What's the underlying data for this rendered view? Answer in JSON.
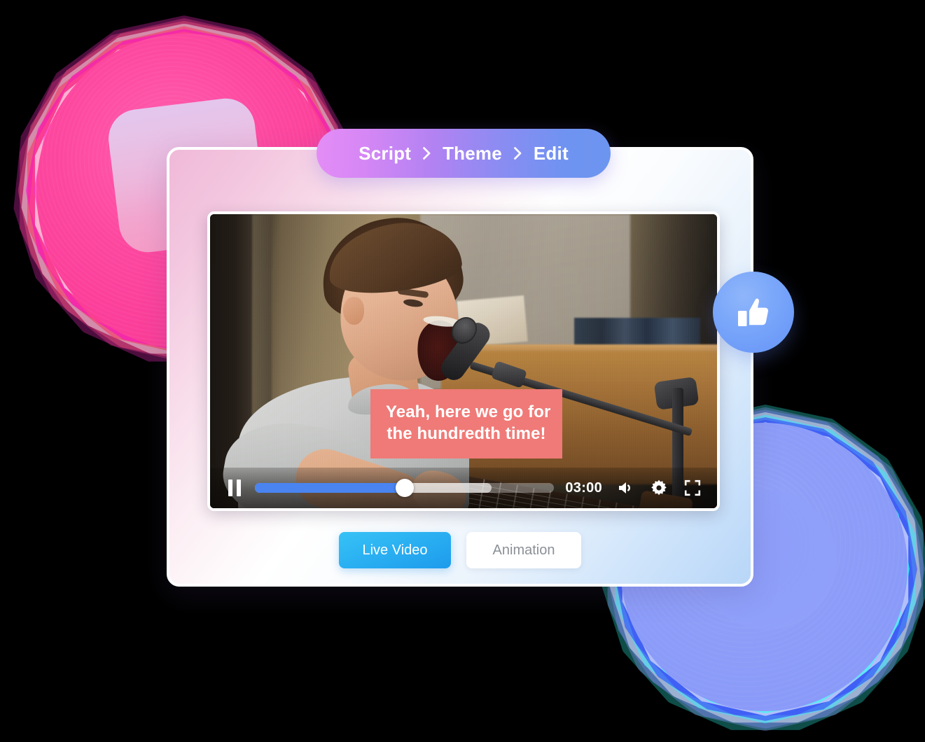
{
  "breadcrumb": {
    "items": [
      {
        "label": "Script"
      },
      {
        "label": "Theme"
      },
      {
        "label": "Edit"
      }
    ],
    "separator": "›",
    "gradient_start": "#E48DF6",
    "gradient_end": "#6C95F0"
  },
  "card": {
    "gradient_start": "#F0B9D8",
    "gradient_mid": "#FFFFFF",
    "gradient_end": "#B8D6F8"
  },
  "video": {
    "caption": {
      "lines": [
        "Yeah, here we go for",
        "the hundredth time!"
      ],
      "background": "#EF7A77",
      "text_color": "#FFFFFF"
    },
    "controls": {
      "play_state": "paused",
      "pause_icon": "pause-icon",
      "progress_percent": 50,
      "buffer_percent": 79,
      "time": "03:00",
      "volume_icon": "volume-icon",
      "settings_icon": "gear-icon",
      "fullscreen_icon": "fullscreen-icon",
      "fill_color": "#4A84F0"
    },
    "scene": {
      "description": "singer-with-guitar"
    }
  },
  "tabs": [
    {
      "label": "Live Video",
      "active": true
    },
    {
      "label": "Animation",
      "active": false
    }
  ],
  "badge": {
    "icon": "thumbs-up-icon",
    "color": "#7CA8FA"
  },
  "decor": {
    "pink_blob_color": "#FB3E99",
    "blue_blob_color": "#8A9AF8",
    "rounded_square_start": "#E3C6EE",
    "rounded_square_end": "#F59BC6"
  }
}
